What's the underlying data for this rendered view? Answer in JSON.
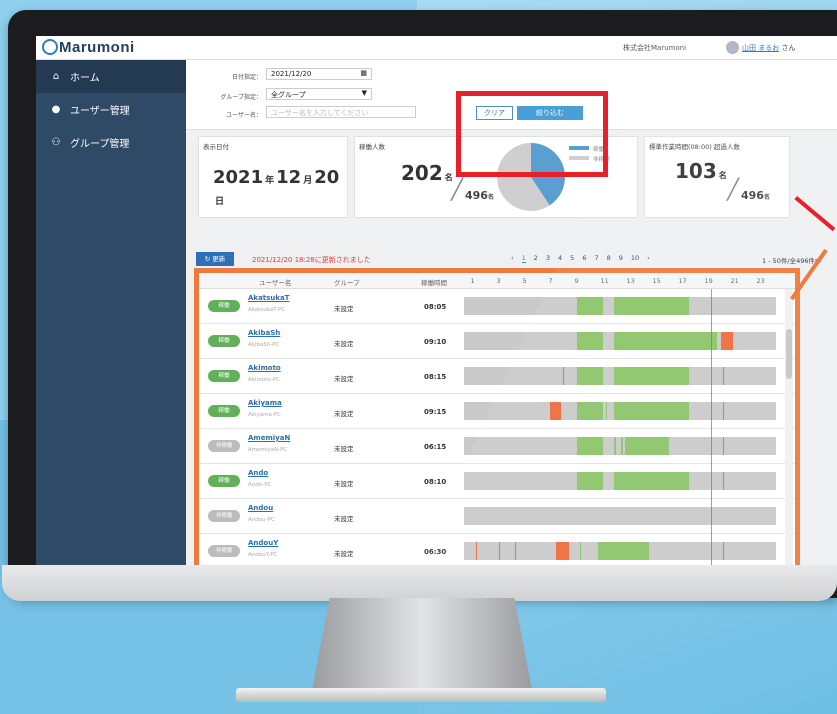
{
  "header": {
    "logo": "Marumoni",
    "company": "株式会社Marumoni",
    "user_name": "山田 まるお",
    "user_suffix": "さん"
  },
  "sidebar": {
    "items": [
      {
        "label": "ホーム",
        "icon": "home-icon",
        "glyph": "⌂"
      },
      {
        "label": "ユーザー管理",
        "icon": "user-icon",
        "glyph": "●"
      },
      {
        "label": "グループ管理",
        "icon": "group-icon",
        "glyph": "⚇"
      }
    ]
  },
  "filters": {
    "date_label": "日付指定：",
    "date_value": "2021/12/20",
    "group_label": "グループ指定：",
    "group_value": "全グループ",
    "user_label": "ユーザー名：",
    "user_placeholder": "ユーザー名を入力してください",
    "clear_label": "クリア",
    "apply_label": "絞り込む"
  },
  "cards": {
    "date": {
      "label": "表示日付",
      "year": "2021",
      "year_unit": "年",
      "month": "12",
      "month_unit": "月",
      "day": "20",
      "day_unit": "日"
    },
    "working": {
      "label": "稼働人数",
      "count": "202",
      "unit": "名",
      "total": "496",
      "total_unit": "名",
      "legend_on": "稼働",
      "legend_off": "非稼働",
      "working_fraction": 0.407
    },
    "overtime": {
      "label": "標準作業時間(08:00) 超過人数",
      "count": "103",
      "unit": "名",
      "total": "496",
      "total_unit": "名"
    }
  },
  "colors": {
    "on": "#62b15a",
    "off": "#bcbcbc",
    "pie_on": "#5a9fd0",
    "pie_off": "#cfcfcf",
    "alert": "#e8202a"
  },
  "toolbar": {
    "refresh_label": "更新",
    "updated_text": "2021/12/20 18:28に更新されました",
    "pages": [
      "‹",
      "1",
      "2",
      "3",
      "4",
      "5",
      "6",
      "7",
      "8",
      "9",
      "10",
      "›"
    ],
    "current_page": "1",
    "range": "1 - 50件/全496件中"
  },
  "table": {
    "columns": {
      "user": "ユーザー名",
      "group": "グループ",
      "hours": "稼働時間"
    },
    "hour_ticks": [
      "1",
      "3",
      "5",
      "7",
      "9",
      "11",
      "13",
      "15",
      "17",
      "19",
      "21",
      "23"
    ],
    "rows": [
      {
        "status": "稼働",
        "on": true,
        "name": "AkatsukaT",
        "pc": "AkatsukaT-PC",
        "group": "未設定",
        "hours": "08:05",
        "segs": [
          [
            "g",
            8.7,
            10.7
          ],
          [
            "g",
            11.5,
            17.3
          ]
        ]
      },
      {
        "status": "稼働",
        "on": true,
        "name": "AkibaSh",
        "pc": "AkibaSh-PC",
        "group": "未設定",
        "hours": "09:10",
        "segs": [
          [
            "g",
            8.7,
            10.7
          ],
          [
            "g",
            11.5,
            17.3
          ],
          [
            "g",
            17.3,
            19.5
          ],
          [
            "o",
            19.8,
            20.7
          ]
        ]
      },
      {
        "status": "稼働",
        "on": true,
        "name": "Akimoto",
        "pc": "Akimoto-PC",
        "group": "未設定",
        "hours": "08:15",
        "segs": [
          [
            "o",
            7.6,
            7.7
          ],
          [
            "g",
            8.7,
            10.7
          ],
          [
            "g",
            11.5,
            17.3
          ],
          [
            "o",
            19.9,
            20.0
          ]
        ]
      },
      {
        "status": "稼働",
        "on": true,
        "name": "Akiyama",
        "pc": "Akiyama-PC",
        "group": "未設定",
        "hours": "09:15",
        "segs": [
          [
            "o",
            6.6,
            7.5
          ],
          [
            "g",
            8.7,
            10.7
          ],
          [
            "g",
            10.9,
            11.0
          ],
          [
            "g",
            11.5,
            17.3
          ],
          [
            "o",
            19.9,
            20.0
          ]
        ]
      },
      {
        "status": "非稼働",
        "on": false,
        "name": "AmemiyaN",
        "pc": "AmemiyaN-PC",
        "group": "未設定",
        "hours": "06:15",
        "segs": [
          [
            "g",
            8.7,
            10.7
          ],
          [
            "g",
            11.5,
            11.7
          ],
          [
            "g",
            12.1,
            12.2
          ],
          [
            "g",
            12.4,
            15.8
          ],
          [
            "o",
            19.9,
            20.0
          ]
        ]
      },
      {
        "status": "稼働",
        "on": true,
        "name": "Ando",
        "pc": "Ando-PC",
        "group": "未設定",
        "hours": "08:10",
        "segs": [
          [
            "g",
            8.7,
            10.7
          ],
          [
            "g",
            11.5,
            17.3
          ],
          [
            "o",
            19.9,
            20.0
          ]
        ]
      },
      {
        "status": "非稼働",
        "on": false,
        "name": "Andou",
        "pc": "Andou-PC",
        "group": "未設定",
        "hours": "",
        "segs": []
      },
      {
        "status": "非稼働",
        "on": false,
        "name": "AndouY",
        "pc": "AndouY-PC",
        "group": "未設定",
        "hours": "06:30",
        "segs": [
          [
            "o",
            0.9,
            1.0
          ],
          [
            "o",
            2.7,
            2.8
          ],
          [
            "o",
            3.9,
            4.0
          ],
          [
            "o",
            7.1,
            8.1
          ],
          [
            "g",
            8.9,
            9.0
          ],
          [
            "g",
            10.3,
            14.2
          ],
          [
            "o",
            19.9,
            20.0
          ]
        ]
      }
    ]
  }
}
